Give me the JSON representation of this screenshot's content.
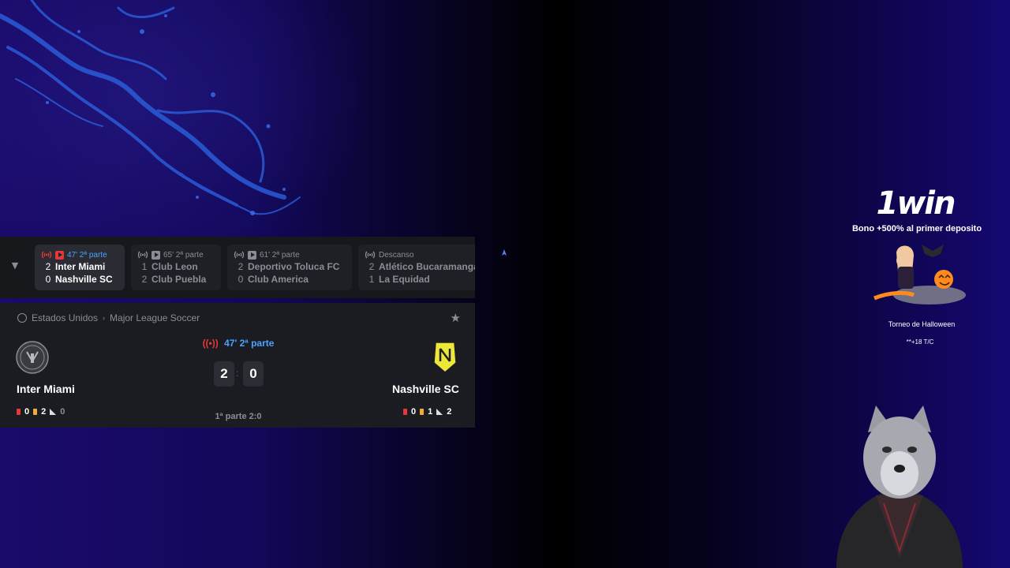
{
  "live_bar": {
    "matches": [
      {
        "status": "47' 2ª parte",
        "home_score": "2",
        "home": "Inter Miami",
        "away_score": "0",
        "away": "Nashville SC"
      },
      {
        "status": "65' 2ª parte",
        "home_score": "1",
        "home": "Club Leon",
        "away_score": "2",
        "away": "Club Puebla"
      },
      {
        "status": "61' 2ª parte",
        "home_score": "2",
        "home": "Deportivo Toluca FC",
        "away_score": "0",
        "away": "Club America"
      },
      {
        "status": "Descanso",
        "home_score": "2",
        "home": "Atlético Bucaramanga",
        "away_score": "1",
        "away": "La Equidad"
      }
    ]
  },
  "scoreboard": {
    "country": "Estados Unidos",
    "league": "Major League Soccer",
    "status": "47' 2ª parte",
    "home": {
      "name": "Inter Miami",
      "score": "2",
      "red": "0",
      "yellow": "2",
      "corners": "0"
    },
    "away": {
      "name": "Nashville SC",
      "score": "0",
      "red": "0",
      "yellow": "1",
      "corners": "2"
    },
    "half_time": "1ª parte 2:0"
  },
  "ad": {
    "brand": "1win",
    "bonus": "Bono +500% al primer deposito",
    "tournament": "Torneo de Halloween",
    "terms": "**+18 T/C"
  },
  "colors": {
    "live": "#e5383b",
    "accent": "#4aa3ff",
    "card_yellow": "#f2a93b"
  }
}
